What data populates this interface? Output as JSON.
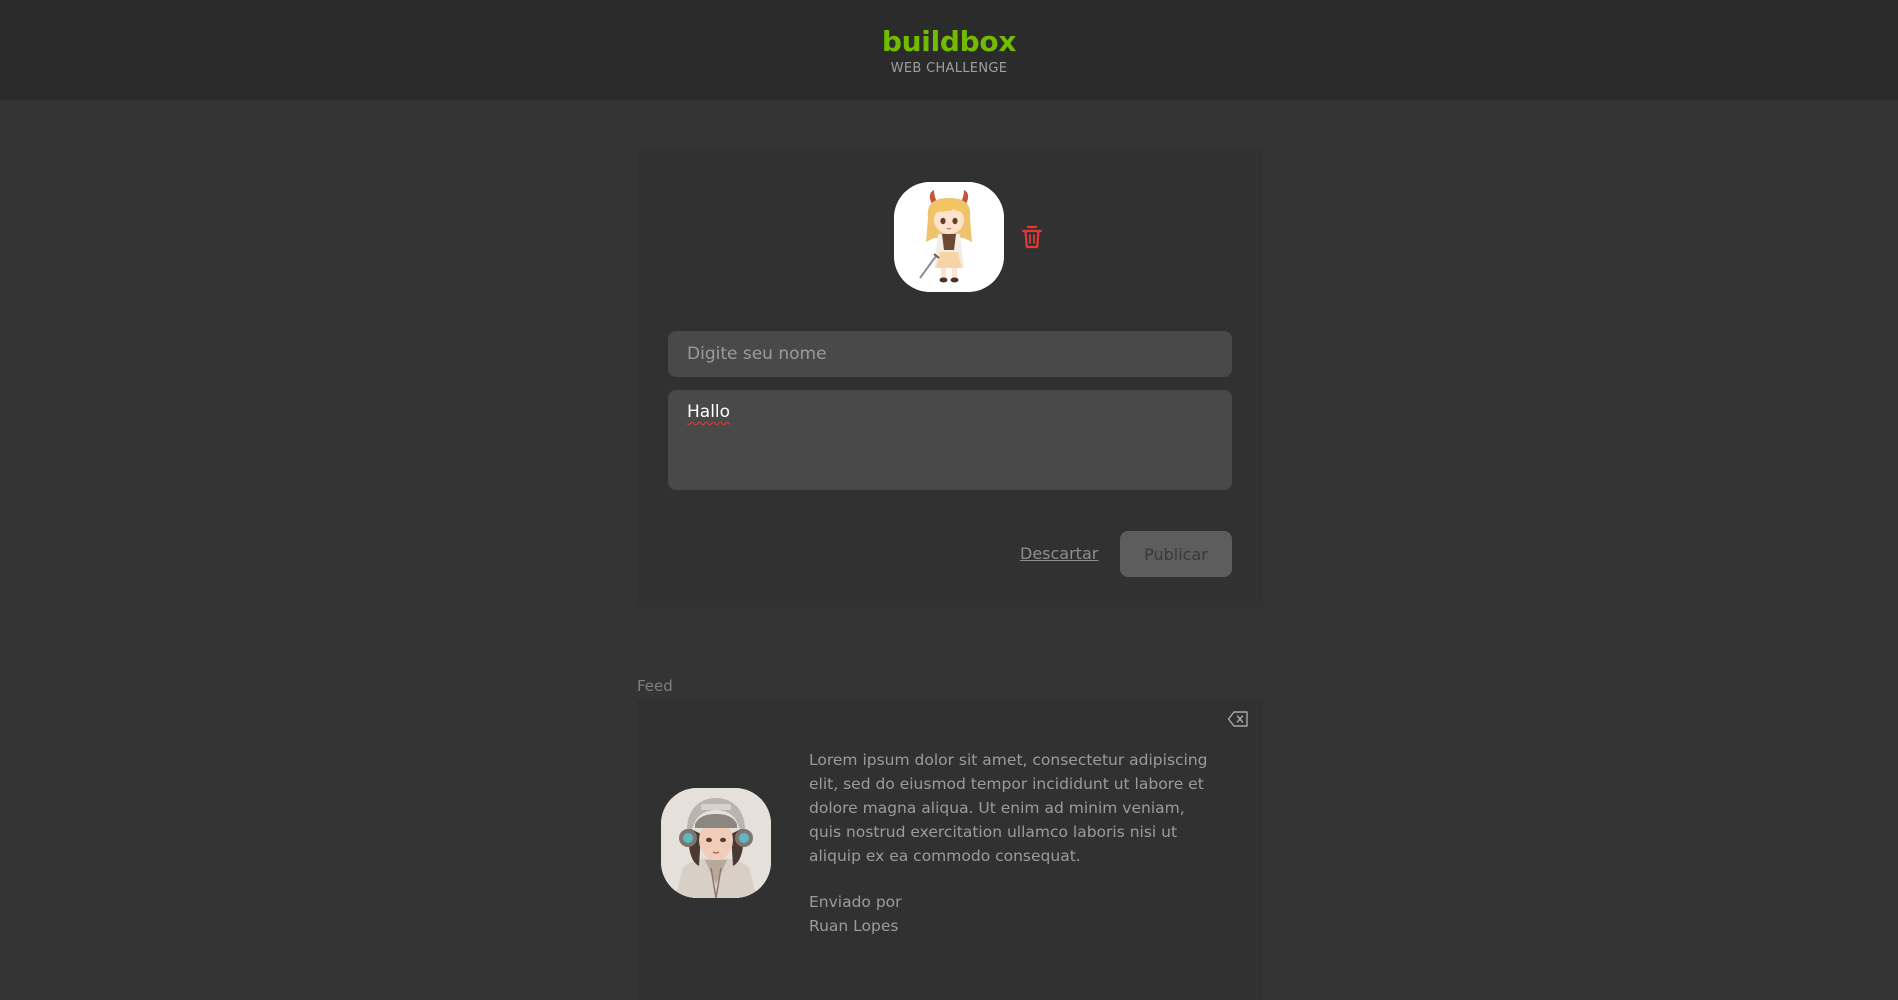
{
  "header": {
    "brand": "buildbox",
    "subtitle": "WEB CHALLENGE"
  },
  "composer": {
    "avatar_icon": "anime-girl-avatar",
    "delete_icon": "trash-icon",
    "name_placeholder": "Digite seu nome",
    "name_value": "",
    "message_value": "Hallo",
    "discard_label": "Descartar",
    "publish_label": "Publicar"
  },
  "feed": {
    "label": "Feed",
    "posts": [
      {
        "avatar_icon": "girl-headphones-avatar",
        "remove_icon": "backspace-icon",
        "message": "Lorem ipsum dolor sit amet, consectetur adipiscing elit, sed do eiusmod tempor incididunt ut labore et dolore magna aliqua. Ut enim ad minim veniam, quis nostrud exercitation ullamco laboris nisi ut aliquip ex ea commodo consequat.",
        "sent_by_label": "Enviado por",
        "author": "Ruan Lopes"
      }
    ]
  },
  "colors": {
    "brand": "#71bb00",
    "background": "#343434",
    "card": "#313131",
    "delete": "#e53935"
  }
}
